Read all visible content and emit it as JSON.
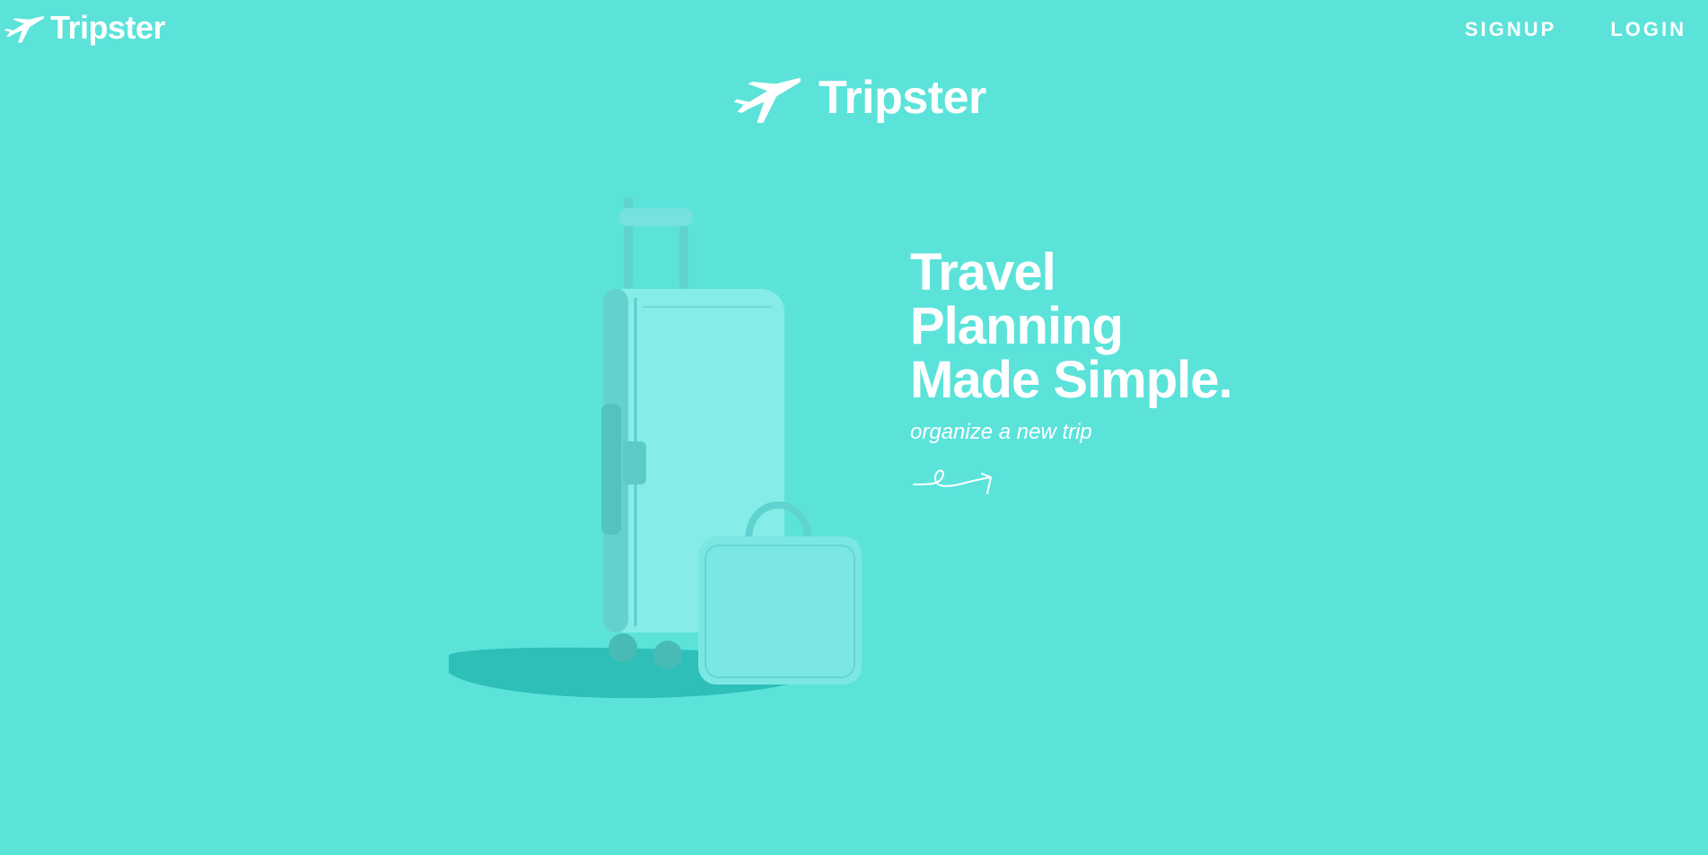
{
  "nav": {
    "brand": "Tripster",
    "brand_icon": "airplane-icon",
    "links": [
      "SIGNUP",
      "LOGIN"
    ]
  },
  "center_logo": {
    "brand": "Tripster",
    "icon": "airplane-icon"
  },
  "hero": {
    "heading_lines": [
      "Travel",
      "Planning",
      "Made Simple."
    ],
    "subtitle": "organize a new trip",
    "arrow_icon": "hand-drawn-arrow-icon",
    "image": "luggage-illustration"
  },
  "colors": {
    "background": "#5be3da",
    "text": "#ffffff",
    "luggage_main": "#86ece8",
    "luggage_shadow": "#1fb3ad"
  }
}
